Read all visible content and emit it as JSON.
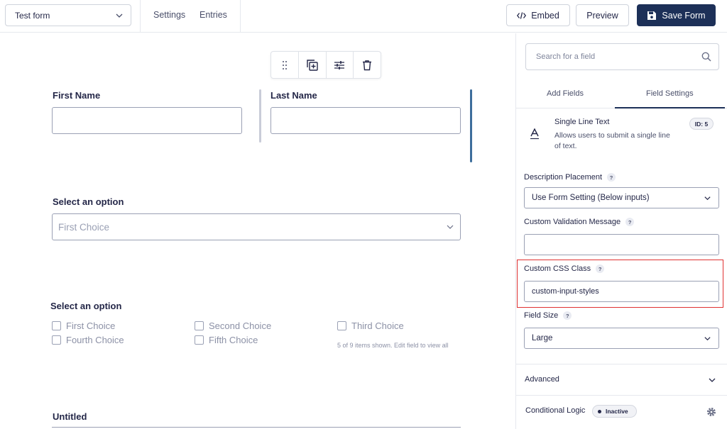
{
  "topbar": {
    "form_select": "Test form",
    "settings": "Settings",
    "entries": "Entries",
    "embed": "Embed",
    "preview": "Preview",
    "save": "Save Form"
  },
  "canvas": {
    "first_name": "First Name",
    "last_name": "Last Name",
    "select_label": "Select an option",
    "select_placeholder": "First Choice",
    "checkbox_label": "Select an option",
    "choices": [
      "First Choice",
      "Second Choice",
      "Third Choice",
      "Fourth Choice",
      "Fifth Choice"
    ],
    "choices_note": "5 of 9 items shown. Edit field to view all",
    "untitled": "Untitled"
  },
  "panel": {
    "search_placeholder": "Search for a field",
    "tab_add": "Add Fields",
    "tab_settings": "Field Settings",
    "field_title": "Single Line Text",
    "field_desc": "Allows users to submit a single line of text.",
    "field_id": "ID: 5",
    "desc_placement_label": "Description Placement",
    "desc_placement_value": "Use Form Setting (Below inputs)",
    "validation_label": "Custom Validation Message",
    "validation_value": "",
    "css_label": "Custom CSS Class",
    "css_value": "custom-input-styles",
    "size_label": "Field Size",
    "size_value": "Large",
    "advanced": "Advanced",
    "conditional": "Conditional Logic",
    "conditional_status": "Inactive"
  },
  "colors": {
    "primary": "#1d3058",
    "active_column": "#3e6e9c",
    "inactive_column": "#c9ccd8",
    "highlight": "#e03131"
  }
}
